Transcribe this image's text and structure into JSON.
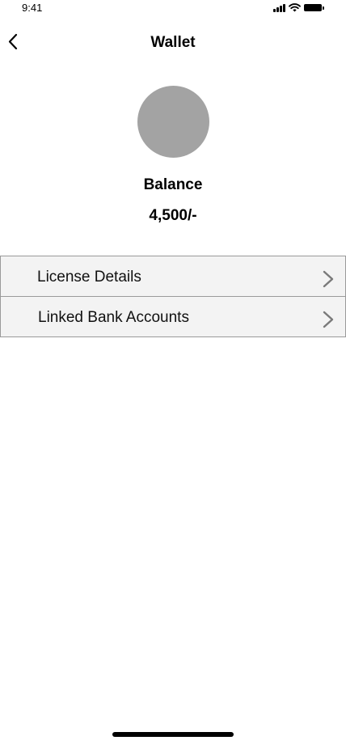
{
  "status_bar": {
    "time": "9:41",
    "icons": [
      "signal-icon",
      "wifi-icon",
      "battery-icon"
    ]
  },
  "nav": {
    "title": "Wallet",
    "back_icon": "chevron-left-icon"
  },
  "profile": {
    "avatar_color": "#a3a3a3"
  },
  "balance": {
    "label": "Balance",
    "value": "4,500/-"
  },
  "menu": {
    "items": [
      {
        "label": "License Details",
        "icon": "chevron-right-icon"
      },
      {
        "label": "Linked Bank Accounts",
        "icon": "chevron-right-icon"
      }
    ]
  }
}
